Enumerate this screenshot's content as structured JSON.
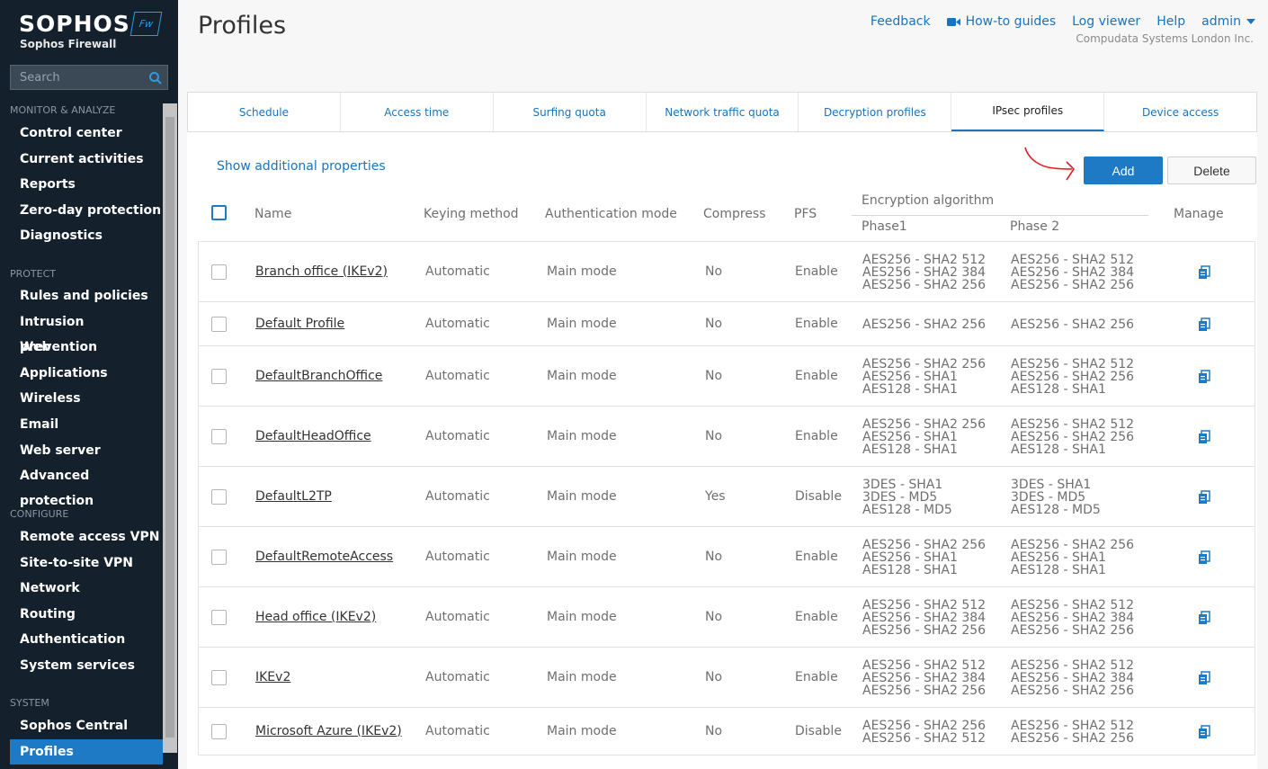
{
  "brand": {
    "name": "SOPHOS",
    "badge": "Fw",
    "product": "Sophos Firewall"
  },
  "search": {
    "placeholder": "Search"
  },
  "nav": {
    "sections": [
      {
        "title": "MONITOR & ANALYZE",
        "items": [
          "Control center",
          "Current activities",
          "Reports",
          "Zero-day protection",
          "Diagnostics"
        ]
      },
      {
        "title": "PROTECT",
        "items": [
          "Rules and policies",
          "Intrusion prevention",
          "Web",
          "Applications",
          "Wireless",
          "Email",
          "Web server",
          "Advanced protection"
        ]
      },
      {
        "title": "CONFIGURE",
        "items": [
          "Remote access VPN",
          "Site-to-site VPN",
          "Network",
          "Routing",
          "Authentication",
          "System services"
        ]
      },
      {
        "title": "SYSTEM",
        "items": [
          "Sophos Central",
          "Profiles"
        ]
      }
    ],
    "active": "Profiles"
  },
  "header": {
    "title": "Profiles",
    "links": {
      "feedback": "Feedback",
      "howto": "How-to guides",
      "log": "Log viewer",
      "help": "Help",
      "user": "admin"
    },
    "company": "Compudata Systems London Inc."
  },
  "tabs": [
    "Schedule",
    "Access time",
    "Surfing quota",
    "Network traffic quota",
    "Decryption profiles",
    "IPsec profiles",
    "Device access"
  ],
  "active_tab": "IPsec profiles",
  "toolbar": {
    "show_props": "Show additional properties",
    "add": "Add",
    "delete": "Delete"
  },
  "columns": {
    "name": "Name",
    "keying": "Keying method",
    "auth": "Authentication mode",
    "compress": "Compress",
    "pfs": "PFS",
    "enc": "Encryption algorithm",
    "phase1": "Phase1",
    "phase2": "Phase 2",
    "manage": "Manage"
  },
  "rows": [
    {
      "name": "Branch office (IKEv2)",
      "keying": "Automatic",
      "auth": "Main mode",
      "compress": "No",
      "pfs": "Enable",
      "phase1": [
        "AES256 - SHA2 512",
        "AES256 - SHA2 384",
        "AES256 - SHA2 256"
      ],
      "phase2": [
        "AES256 - SHA2 512",
        "AES256 - SHA2 384",
        "AES256 - SHA2 256"
      ]
    },
    {
      "name": "Default Profile",
      "keying": "Automatic",
      "auth": "Main mode",
      "compress": "No",
      "pfs": "Enable",
      "phase1": [
        "AES256 - SHA2 256"
      ],
      "phase2": [
        "AES256 - SHA2 256"
      ]
    },
    {
      "name": "DefaultBranchOffice",
      "keying": "Automatic",
      "auth": "Main mode",
      "compress": "No",
      "pfs": "Enable",
      "phase1": [
        "AES256 - SHA2 256",
        "AES256 - SHA1",
        "AES128 - SHA1"
      ],
      "phase2": [
        "AES256 - SHA2 512",
        "AES256 - SHA2 256",
        "AES128 - SHA1"
      ]
    },
    {
      "name": "DefaultHeadOffice",
      "keying": "Automatic",
      "auth": "Main mode",
      "compress": "No",
      "pfs": "Enable",
      "phase1": [
        "AES256 - SHA2 256",
        "AES256 - SHA1",
        "AES128 - SHA1"
      ],
      "phase2": [
        "AES256 - SHA2 512",
        "AES256 - SHA2 256",
        "AES128 - SHA1"
      ]
    },
    {
      "name": "DefaultL2TP",
      "keying": "Automatic",
      "auth": "Main mode",
      "compress": "Yes",
      "pfs": "Disable",
      "phase1": [
        "3DES - SHA1",
        "3DES - MD5",
        "AES128 - MD5"
      ],
      "phase2": [
        "3DES - SHA1",
        "3DES - MD5",
        "AES128 - MD5"
      ]
    },
    {
      "name": "DefaultRemoteAccess",
      "keying": "Automatic",
      "auth": "Main mode",
      "compress": "No",
      "pfs": "Enable",
      "phase1": [
        "AES256 - SHA2 256",
        "AES256 - SHA1",
        "AES128 - SHA1"
      ],
      "phase2": [
        "AES256 - SHA2 256",
        "AES256 - SHA1",
        "AES128 - SHA1"
      ]
    },
    {
      "name": "Head office (IKEv2)",
      "keying": "Automatic",
      "auth": "Main mode",
      "compress": "No",
      "pfs": "Enable",
      "phase1": [
        "AES256 - SHA2 512",
        "AES256 - SHA2 384",
        "AES256 - SHA2 256"
      ],
      "phase2": [
        "AES256 - SHA2 512",
        "AES256 - SHA2 384",
        "AES256 - SHA2 256"
      ]
    },
    {
      "name": "IKEv2",
      "keying": "Automatic",
      "auth": "Main mode",
      "compress": "No",
      "pfs": "Enable",
      "phase1": [
        "AES256 - SHA2 512",
        "AES256 - SHA2 384",
        "AES256 - SHA2 256"
      ],
      "phase2": [
        "AES256 - SHA2 512",
        "AES256 - SHA2 384",
        "AES256 - SHA2 256"
      ]
    },
    {
      "name": "Microsoft Azure (IKEv2)",
      "keying": "Automatic",
      "auth": "Main mode",
      "compress": "No",
      "pfs": "Disable",
      "phase1": [
        "AES256 - SHA2 256",
        "AES256 - SHA2 512"
      ],
      "phase2": [
        "AES256 - SHA2 512",
        "AES256 - SHA2 256"
      ]
    }
  ],
  "colors": {
    "sidebar_bg": "#14202c",
    "accent": "#1f7ac5",
    "link": "#1a73bd",
    "annotation": "#e02020"
  }
}
